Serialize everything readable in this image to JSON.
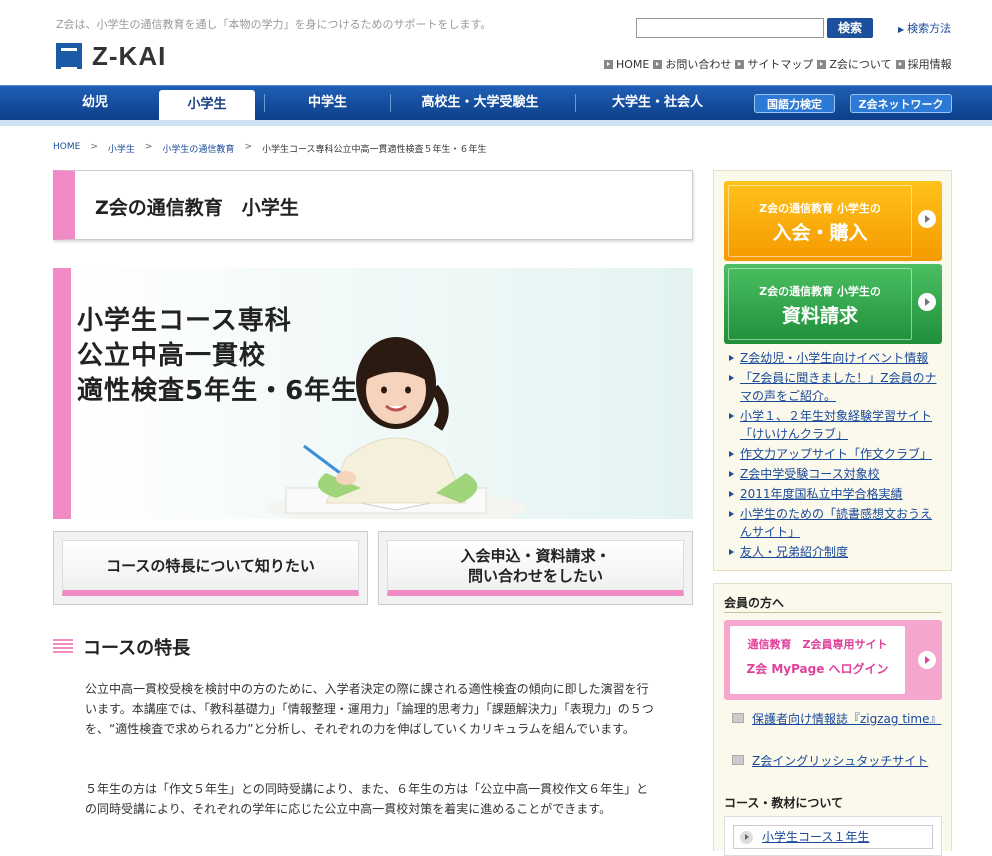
{
  "header": {
    "tagline": "Z会は、小学生の通信教育を通し「本物の学力」を身につけるためのサポートをします。",
    "logo_text": "Z-KAI",
    "search": {
      "placeholder": "",
      "button_label": "検索",
      "help_label": "検索方法"
    },
    "util_links": [
      "HOME",
      "お問い合わせ",
      "サイトマップ",
      "Z会について",
      "採用情報"
    ]
  },
  "gnav": {
    "items": [
      "幼児",
      "小学生",
      "中学生",
      "高校生・大学受験生",
      "大学生・社会人"
    ],
    "active": "小学生",
    "pills": [
      "国語力検定",
      "Z会ネットワーク"
    ]
  },
  "breadcrumb": {
    "links": [
      "HOME",
      "小学生",
      "小学生の通信教育"
    ],
    "separator": ">",
    "current": "小学生コース専科公立中高一貫適性検査５年生・６年生"
  },
  "page_title": "Z会の通信教育　小学生",
  "hero": {
    "lines": [
      "小学生コース専科",
      "公立中高一貫校",
      "適性検査5年生・6年生"
    ]
  },
  "buttons": {
    "features": "コースの特長について知りたい",
    "apply_line1": "入会申込・資料請求・",
    "apply_line2": "問い合わせをしたい"
  },
  "section": {
    "title": "コースの特長",
    "para1": "公立中高一貫校受検を検討中の方のために、入学者決定の際に課される適性検査の傾向に即した演習を行います。本講座では、「教科基礎力」「情報整理・運用力」「論理的思考力」「課題解決力」「表現力」の５つを、“適性検査で求められる力”と分析し、それぞれの力を伸ばしていくカリキュラムを組んでいます。",
    "para2": "５年生の方は「作文５年生」との同時受講により、また、６年生の方は「公立中高一貫校作文６年生」との同時受講により、それぞれの学年に応じた公立中高一貫校対策を着実に進めることができます。"
  },
  "sidebar": {
    "join": {
      "small": "Z会の通信教育 小学生の",
      "large": "入会・購入"
    },
    "docs": {
      "small": "Z会の通信教育 小学生の",
      "large": "資料請求"
    },
    "links": [
      "Z会幼児・小学生向けイベント情報",
      "「Z会員に聞きました！」Z会員のナマの声をご紹介。",
      "小学１、２年生対象経験学習サイト「けいけんクラブ」",
      "作文力アップサイト「作文クラブ」",
      "Z会中学受験コース対象校",
      "2011年度国私立中学合格実績",
      "小学生のための「読書感想文おうえんサイト」",
      "友人・兄弟紹介制度"
    ]
  },
  "member": {
    "heading": "会員の方へ",
    "mypage_line1": "通信教育　Z会員専用サイト",
    "mypage_line2": "Z会 MyPage へログイン",
    "doc_links": [
      "保護者向け情報誌『zigzag time』",
      "Z会イングリッシュタッチサイト"
    ],
    "course_heading": "コース・教材について",
    "course_item": "小学生コース１年生"
  },
  "colors": {
    "brand_blue": "#1a5aa6",
    "accent_pink": "#f08ac4",
    "join_orange": "#f5a30a",
    "docs_green": "#34a853"
  }
}
